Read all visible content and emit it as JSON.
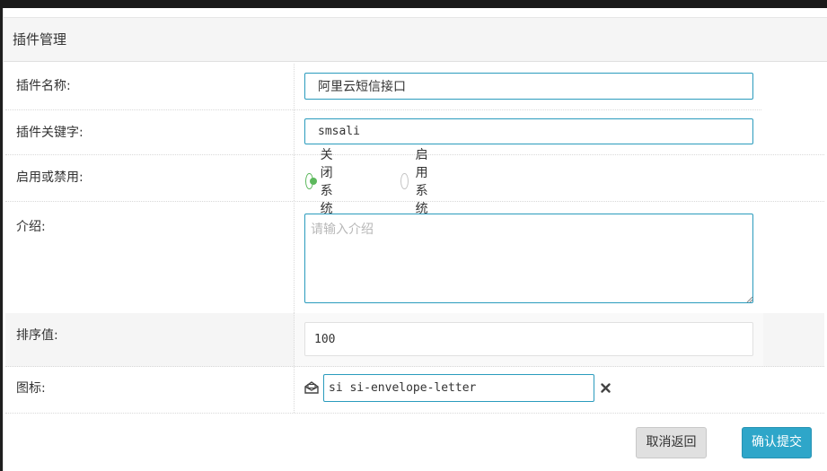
{
  "header": {
    "title": "插件管理"
  },
  "form": {
    "name": {
      "label": "插件名称:",
      "value": "阿里云短信接口"
    },
    "keyword": {
      "label": "插件关键字:",
      "value": "smsali"
    },
    "status": {
      "label": "启用或禁用:",
      "options": [
        {
          "label": "关闭系统",
          "checked": true
        },
        {
          "label": "启用系统",
          "checked": false
        }
      ]
    },
    "intro": {
      "label": "介绍:",
      "placeholder": "请输入介绍",
      "value": ""
    },
    "sort": {
      "label": "排序值:",
      "value": "100"
    },
    "icon": {
      "label": "图标:",
      "value": "si si-envelope-letter",
      "icon_name": "envelope-letter-icon",
      "clear_icon": "close-icon"
    }
  },
  "actions": {
    "cancel_label": "取消返回",
    "submit_label": "确认提交"
  }
}
